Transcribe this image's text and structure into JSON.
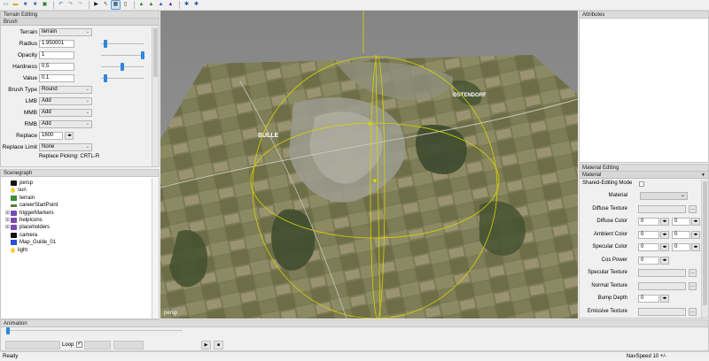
{
  "toolbar": {
    "buttons": [
      {
        "name": "new-file-icon",
        "glyph": "▭",
        "color": "#4a6fa5"
      },
      {
        "name": "open-folder-icon",
        "glyph": "▬",
        "color": "#d4a017"
      },
      {
        "name": "save-icon",
        "glyph": "■",
        "color": "#3b6fb6"
      },
      {
        "name": "save-as-icon",
        "glyph": "■",
        "color": "#3b6fb6"
      },
      {
        "name": "export-icon",
        "glyph": "▣",
        "color": "#2e7d32"
      },
      {
        "name": "undo-icon",
        "glyph": "↶",
        "color": "#3b6fb6"
      },
      {
        "name": "redo-icon",
        "glyph": "↷",
        "color": "#888888"
      },
      {
        "name": "redo-disabled-icon",
        "glyph": "↷",
        "color": "#aaaaaa"
      },
      {
        "name": "play-icon",
        "glyph": "▶",
        "color": "#111111"
      },
      {
        "name": "pointer-icon",
        "glyph": "↖",
        "color": "#333333"
      },
      {
        "name": "select-tool-icon",
        "glyph": "▦",
        "color": "#333333"
      },
      {
        "name": "pause-icon",
        "glyph": "▯",
        "color": "#333333"
      },
      {
        "name": "terrain-tool-icon",
        "glyph": "▲",
        "color": "#2e7d32"
      },
      {
        "name": "terrain-paint-icon",
        "glyph": "▲",
        "color": "#2e7d32"
      },
      {
        "name": "terrain-raise-icon",
        "glyph": "▲",
        "color": "#1565c0"
      },
      {
        "name": "terrain-flatten-icon",
        "glyph": "▲",
        "color": "#6a1b9a"
      },
      {
        "name": "settings-gear-icon",
        "glyph": "✱",
        "color": "#1e5aa8"
      },
      {
        "name": "network-icon",
        "glyph": "✱",
        "color": "#1e5aa8"
      }
    ]
  },
  "terrain_editing": {
    "title": "Terrain Editing",
    "section": "Brush",
    "fields": {
      "terrain": {
        "label": "Terrain",
        "value": "terrain"
      },
      "radius": {
        "label": "Radius",
        "value": "1.950001",
        "slider": 0.1
      },
      "opacity": {
        "label": "Opacity",
        "value": "1",
        "slider": 1.0
      },
      "hardness": {
        "label": "Hardness",
        "value": "0.5",
        "slider": 0.5
      },
      "value": {
        "label": "Value",
        "value": "0.1",
        "slider": 0.1
      },
      "brush_type": {
        "label": "Brush Type",
        "value": "Round"
      },
      "lmb": {
        "label": "LMB",
        "value": "Add"
      },
      "mmb": {
        "label": "MMB",
        "value": "Add"
      },
      "rmb": {
        "label": "RMB",
        "value": "Add"
      },
      "replace": {
        "label": "Replace",
        "value": "1600",
        "spin": "◂▸"
      },
      "replace_limit": {
        "label": "Replace Limit",
        "value": "None"
      },
      "replace_picking": "Replace Picking: CRTL-R"
    }
  },
  "scenegraph": {
    "title": "Scenegraph",
    "items": [
      {
        "label": "persp",
        "icon": "camera-icon",
        "expandable": false
      },
      {
        "label": "sun",
        "icon": "lightbulb-icon",
        "expandable": false
      },
      {
        "label": "terrain",
        "icon": "terrain-icon",
        "expandable": false
      },
      {
        "label": "careerStartPoint",
        "icon": "start-point-icon",
        "expandable": false
      },
      {
        "label": "triggerMarkers",
        "icon": "group-icon",
        "expandable": true
      },
      {
        "label": "helpIcons",
        "icon": "group-icon",
        "expandable": true
      },
      {
        "label": "placeholders",
        "icon": "group-icon",
        "expandable": true
      },
      {
        "label": "camera",
        "icon": "camera-icon",
        "expandable": false
      },
      {
        "label": "Map_Guide_01",
        "icon": "cube-icon",
        "expandable": false
      },
      {
        "label": "light",
        "icon": "lightbulb-icon",
        "expandable": false
      }
    ]
  },
  "viewport": {
    "label": "persp",
    "place_labels": [
      "BULLE",
      "OSTENDORF"
    ]
  },
  "attributes": {
    "title": "Attributes"
  },
  "material_editing": {
    "title": "Material Editing",
    "section": "Material",
    "shared_editing_mode": "Shared-Editing Mode",
    "rows": [
      {
        "label": "Material",
        "kind": "select"
      },
      {
        "label": "Diffuse Texture",
        "kind": "texture"
      },
      {
        "label": "Diffuse Color",
        "kind": "color",
        "a": "0",
        "b": "0"
      },
      {
        "label": "Ambient Color",
        "kind": "color",
        "a": "0",
        "b": "0"
      },
      {
        "label": "Specular Color",
        "kind": "color",
        "a": "0",
        "b": "0"
      },
      {
        "label": "Cos Power",
        "kind": "num",
        "a": "0"
      },
      {
        "label": "Specular Texture",
        "kind": "texture"
      },
      {
        "label": "Normal Texture",
        "kind": "texture"
      },
      {
        "label": "Bump Depth",
        "kind": "num",
        "a": "0"
      },
      {
        "label": "Emissive Texture",
        "kind": "texture"
      }
    ]
  },
  "animation": {
    "title": "Animation",
    "loop_label": "Loop",
    "loop_checked": true,
    "play": "▶",
    "stop": "■"
  },
  "status": {
    "left": "Ready",
    "right": "NavSpeed 10 +/-"
  },
  "colors": {
    "accent": "#2e86de",
    "gizmo": "#d8d400",
    "viewport_bg": "#8a8a8a"
  }
}
